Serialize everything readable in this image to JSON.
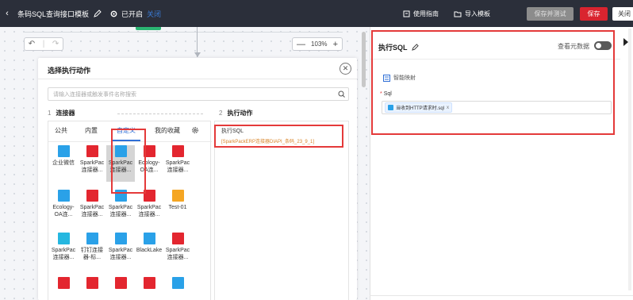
{
  "topbar": {
    "back_icon": "chevron-left-icon",
    "title": "条码SQL查询接口模板",
    "status": "已开启",
    "close_link": "关闭",
    "guide": "使用指南",
    "import": "导入模板",
    "test_btn": "保存并测试",
    "save_btn": "保存",
    "close_btn": "关闭"
  },
  "canvas": {
    "zoom": "103%"
  },
  "panel": {
    "title": "选择执行动作",
    "search_placeholder": "请输入连接器或触发事件名称搜索",
    "step1_num": "1",
    "step1_label": "连接器",
    "step2_num": "2",
    "step2_label": "执行动作",
    "tabs": [
      "公共",
      "内置",
      "自定义",
      "我的收藏"
    ],
    "active_tab": "自定义",
    "connectors": [
      {
        "l1": "企业微信",
        "l2": "",
        "color": "blue"
      },
      {
        "l1": "SparkPac",
        "l2": "连接器...",
        "color": "red"
      },
      {
        "l1": "SparkPac",
        "l2": "连接器...",
        "color": "blue"
      },
      {
        "l1": "Ecology-",
        "l2": "OA连...",
        "color": "red"
      },
      {
        "l1": "SparkPac",
        "l2": "连接器...",
        "color": "red"
      },
      {
        "l1": "Ecology-",
        "l2": "OA连...",
        "color": "blue"
      },
      {
        "l1": "SparkPac",
        "l2": "连接器...",
        "color": "red"
      },
      {
        "l1": "SparkPac",
        "l2": "连接器...",
        "color": "blue"
      },
      {
        "l1": "SparkPac",
        "l2": "连接器...",
        "color": "red"
      },
      {
        "l1": "Test-01",
        "l2": "",
        "color": "orange"
      },
      {
        "l1": "SparkPac",
        "l2": "连接器...",
        "color": "cyan"
      },
      {
        "l1": "钉钉连接",
        "l2": "器-标...",
        "color": "blue"
      },
      {
        "l1": "SparkPac",
        "l2": "连接器...",
        "color": "blue"
      },
      {
        "l1": "BlackLake",
        "l2": "",
        "color": "blue"
      },
      {
        "l1": "SparkPac",
        "l2": "连接器...",
        "color": "red"
      },
      {
        "l1": "",
        "l2": "",
        "color": "red"
      },
      {
        "l1": "",
        "l2": "",
        "color": "red"
      },
      {
        "l1": "",
        "l2": "",
        "color": "red"
      },
      {
        "l1": "",
        "l2": "",
        "color": "red"
      },
      {
        "l1": "",
        "l2": "",
        "color": "blue"
      }
    ],
    "action": {
      "title": "执行SQL",
      "subtitle": "[SparkPackERP连接器DIAPI_条码_23_9_1]"
    }
  },
  "right": {
    "title": "执行SQL",
    "meta_label": "查看元数据",
    "smart_map": "智能映射",
    "sql_label": "Sql",
    "sql_tag": "当收到HTTP请求时.sql"
  }
}
